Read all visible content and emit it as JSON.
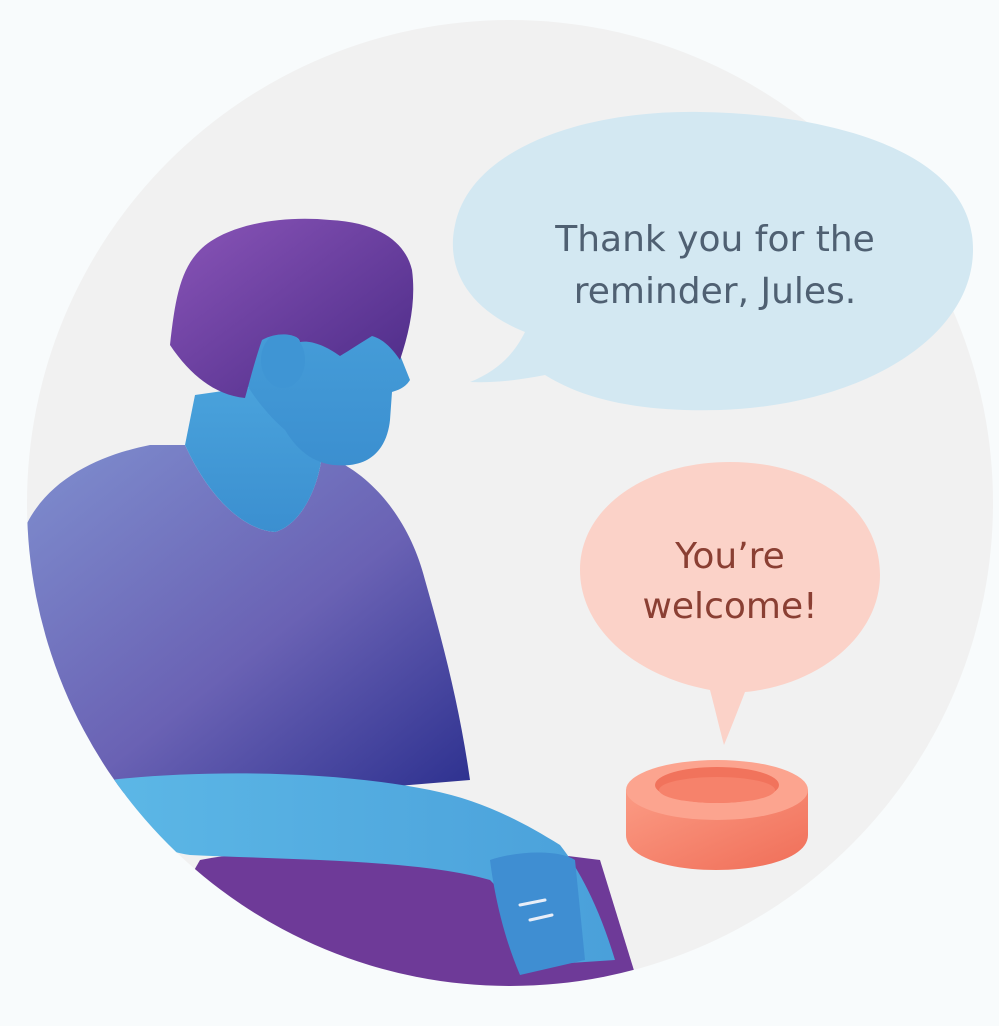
{
  "bubbles": {
    "user": {
      "line1": "Thank you for the",
      "line2": "reminder, Jules."
    },
    "device": {
      "line1": "You’re",
      "line2": "welcome!"
    }
  },
  "colors": {
    "page_background": "#f8fbfc",
    "circle_background": "#f1f1f1",
    "user_bubble": "#d3e8f2",
    "device_bubble": "#fbd2c8",
    "user_text": "#4f6072",
    "device_text": "#8a3f33",
    "hair": "#6f3fa2",
    "skin": "#4fa6dc",
    "shirt": "#6a62b4",
    "pants": "#6e3a98",
    "device": "#f88f78"
  }
}
